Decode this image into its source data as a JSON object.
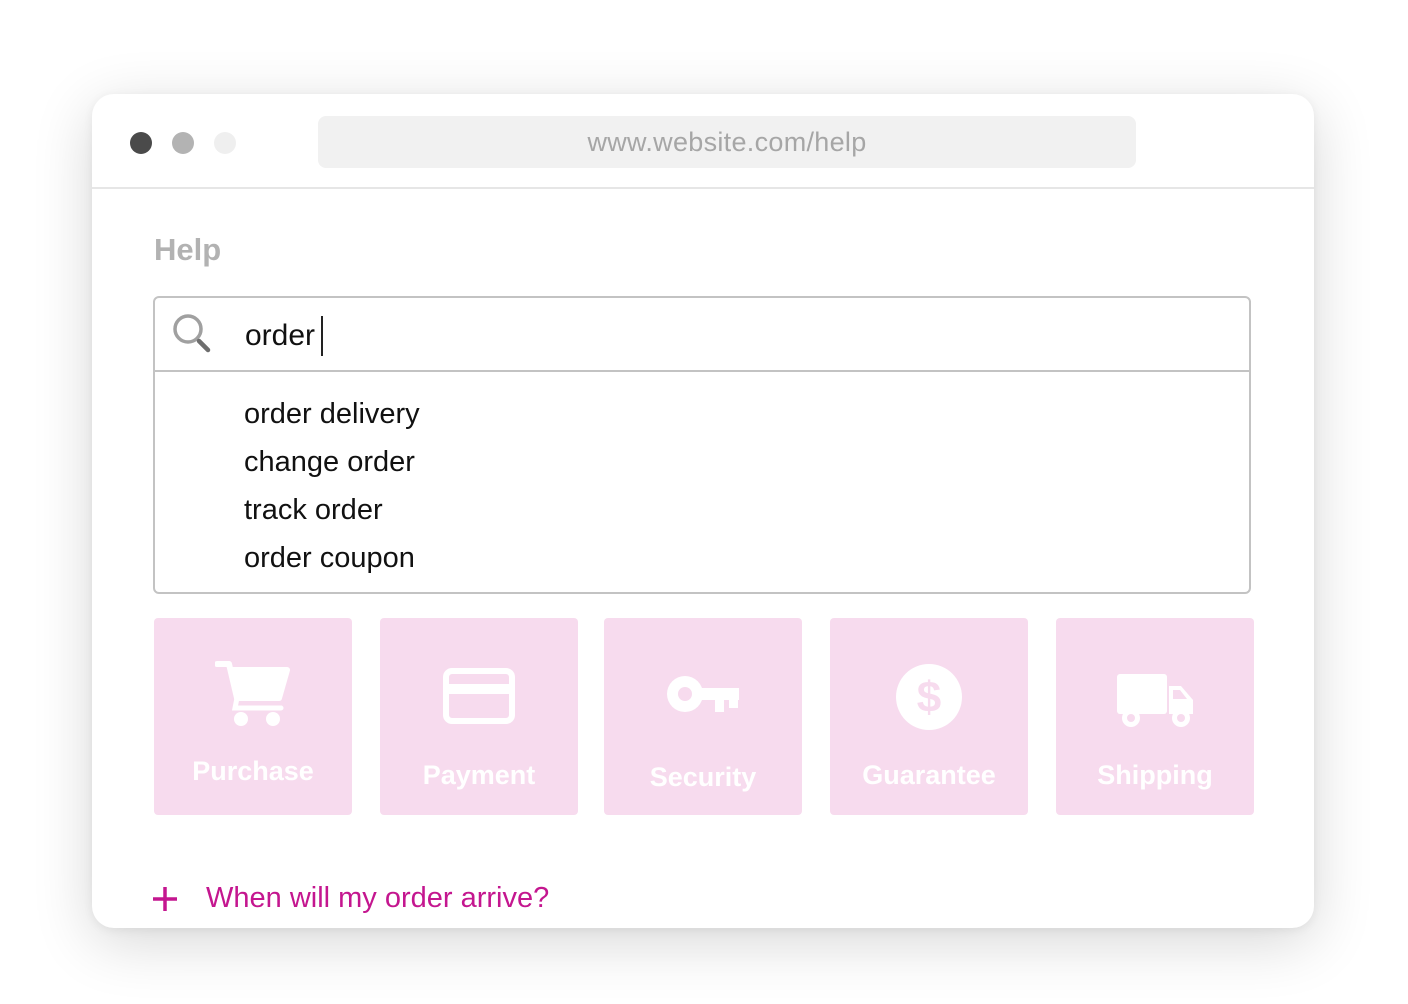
{
  "browser": {
    "url": "www.website.com/help"
  },
  "page": {
    "title": "Help"
  },
  "search": {
    "value": "order",
    "suggestions": [
      "order delivery",
      "change order",
      "track order",
      "order coupon"
    ]
  },
  "categories": [
    {
      "label": "Purchase",
      "icon": "cart-icon"
    },
    {
      "label": "Payment",
      "icon": "credit-card-icon"
    },
    {
      "label": "Security",
      "icon": "key-icon"
    },
    {
      "label": "Guarantee",
      "icon": "dollar-icon"
    },
    {
      "label": "Shipping",
      "icon": "truck-icon"
    }
  ],
  "faq": {
    "question": "When will my order arrive?"
  },
  "colors": {
    "accent": "#c4168f",
    "tile_bg": "#f7dbee",
    "muted_text": "#b2b2b2"
  }
}
